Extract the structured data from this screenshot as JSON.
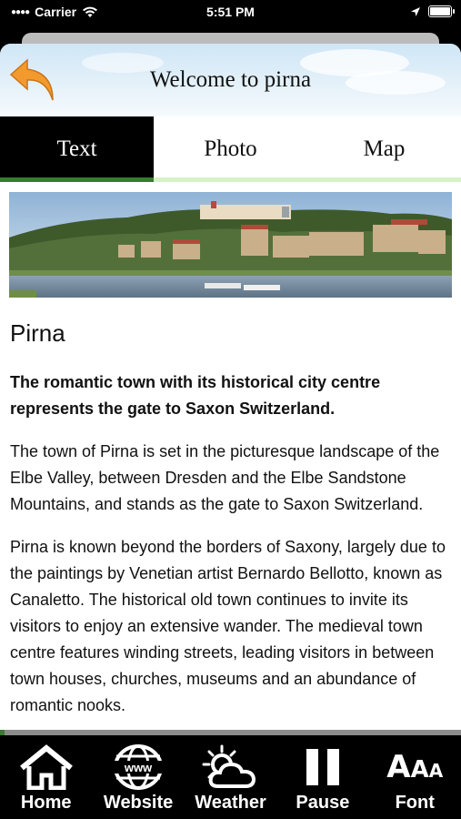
{
  "status_bar": {
    "carrier": "Carrier",
    "time": "5:51 PM"
  },
  "header": {
    "title": "Welcome to pirna"
  },
  "tabs": [
    {
      "label": "Text",
      "active": true
    },
    {
      "label": "Photo",
      "active": false
    },
    {
      "label": "Map",
      "active": false
    }
  ],
  "article": {
    "heading": "Pirna",
    "lead": "The romantic town with its historical city centre represents the gate to Saxon Switzerland.",
    "paragraphs": [
      "The town of Pirna is set in the picturesque landscape of the Elbe Valley, between Dresden and the Elbe Sandstone Mountains, and stands as the gate to Saxon Switzerland.",
      "Pirna is known beyond the borders of Saxony, largely due to the paintings by Venetian artist Bernardo Bellotto, known as Canaletto. The historical old town continues to invite its visitors to enjoy an extensive wander. The medieval town centre features winding streets, leading visitors in between town houses, churches, museums and an abundance of romantic nooks."
    ]
  },
  "toolbar": {
    "items": [
      {
        "label": "Home",
        "icon": "home-icon"
      },
      {
        "label": "Website",
        "icon": "globe-www-icon",
        "badge": "www"
      },
      {
        "label": "Weather",
        "icon": "weather-icon"
      },
      {
        "label": "Pause",
        "icon": "pause-icon"
      },
      {
        "label": "Font",
        "icon": "font-size-icon",
        "glyph": "AAA"
      }
    ]
  },
  "colors": {
    "accent_green": "#3a7a32",
    "light_green": "#d6f2c6",
    "back_arrow": "#f29a2e"
  }
}
